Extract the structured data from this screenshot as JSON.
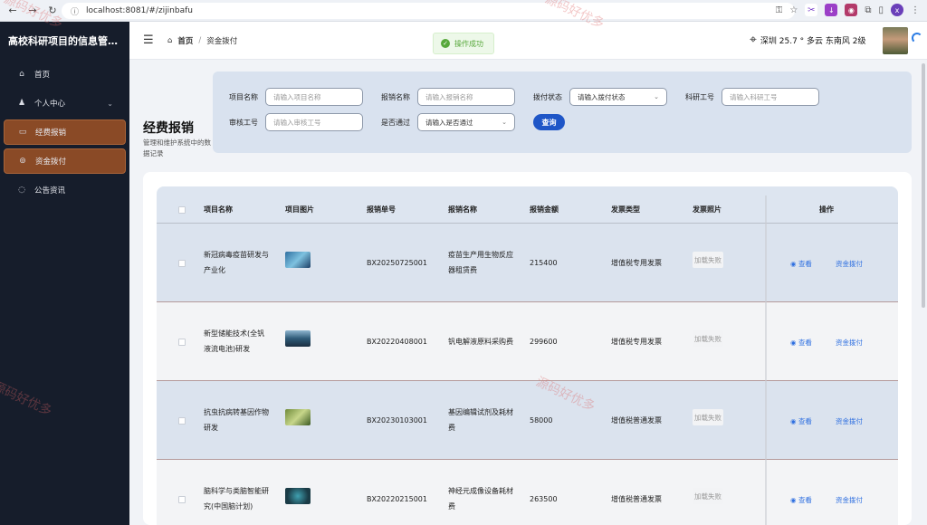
{
  "browser": {
    "url": "localhost:8081/#/zijinbafu"
  },
  "sidebar": {
    "app_title": "高校科研项目的信息管…",
    "items": [
      {
        "label": "首页",
        "icon": "home-icon",
        "active": false
      },
      {
        "label": "个人中心",
        "icon": "user-icon",
        "active": false,
        "has_submenu": true
      },
      {
        "label": "经费报销",
        "icon": "reimburse-icon",
        "active": true
      },
      {
        "label": "资金拨付",
        "icon": "coins-icon",
        "active": true
      },
      {
        "label": "公告资讯",
        "icon": "chat-icon",
        "active": false
      }
    ]
  },
  "header": {
    "breadcrumb_home": "首页",
    "breadcrumb_current": "资金拨付",
    "toast": "操作成功",
    "weather": "深圳 25.7 ° 多云 东南风 2级"
  },
  "page": {
    "title": "经费报销",
    "description": "管理和维护系统中的数据记录"
  },
  "search": {
    "project_name_label": "项目名称",
    "project_name_placeholder": "请输入项目名称",
    "reimb_name_label": "报销名称",
    "reimb_name_placeholder": "请输入报销名称",
    "pay_status_label": "拨付状态",
    "pay_status_value": "请输入拨付状态",
    "research_id_label": "科研工号",
    "research_id_placeholder": "请输入科研工号",
    "auditor_id_label": "审核工号",
    "auditor_id_placeholder": "请输入审核工号",
    "approved_label": "是否通过",
    "approved_value": "请输入是否通过",
    "search_button": "查询"
  },
  "table": {
    "headers": [
      "项目名称",
      "项目图片",
      "报销单号",
      "报销名称",
      "报销金额",
      "发票类型",
      "发票照片",
      "操作"
    ],
    "rows": [
      {
        "project": [
          "新冠病毒疫苗研发与",
          "产业化"
        ],
        "order_no": "BX20250725001",
        "name": [
          "疫苗生产用生物反应",
          "器租赁费"
        ],
        "amount": "215400",
        "invoice_type": "增值税专用发票",
        "invoice_photo": "加载失败",
        "view": "查看",
        "pay": "资金拨付"
      },
      {
        "project": [
          "新型储能技术(全钒",
          "液流电池)研发"
        ],
        "order_no": "BX20220408001",
        "name": [
          "钒电解液原料采购费"
        ],
        "amount": "299600",
        "invoice_type": "增值税专用发票",
        "invoice_photo": "加载失败",
        "view": "查看",
        "pay": "资金拨付"
      },
      {
        "project": [
          "抗虫抗病转基因作物",
          "研发"
        ],
        "order_no": "BX20230103001",
        "name": [
          "基因编辑试剂及耗材",
          "费"
        ],
        "amount": "58000",
        "invoice_type": "增值税普通发票",
        "invoice_photo": "加载失败",
        "view": "查看",
        "pay": "资金拨付"
      },
      {
        "project": [
          "脑科学与类脑智能研",
          "究(中国脑计划)"
        ],
        "order_no": "BX20220215001",
        "name": [
          "神经元成像设备耗材",
          "费"
        ],
        "amount": "263500",
        "invoice_type": "增值税普通发票",
        "invoice_photo": "加载失败",
        "view": "查看",
        "pay": "资金拨付"
      }
    ]
  },
  "watermark": "源码好优多",
  "colors": {
    "sidebar_bg": "#161d2b",
    "active_menu": "#8a4a26",
    "primary": "#1f56c7",
    "link": "#2e6fe0",
    "success": "#57a83b"
  }
}
